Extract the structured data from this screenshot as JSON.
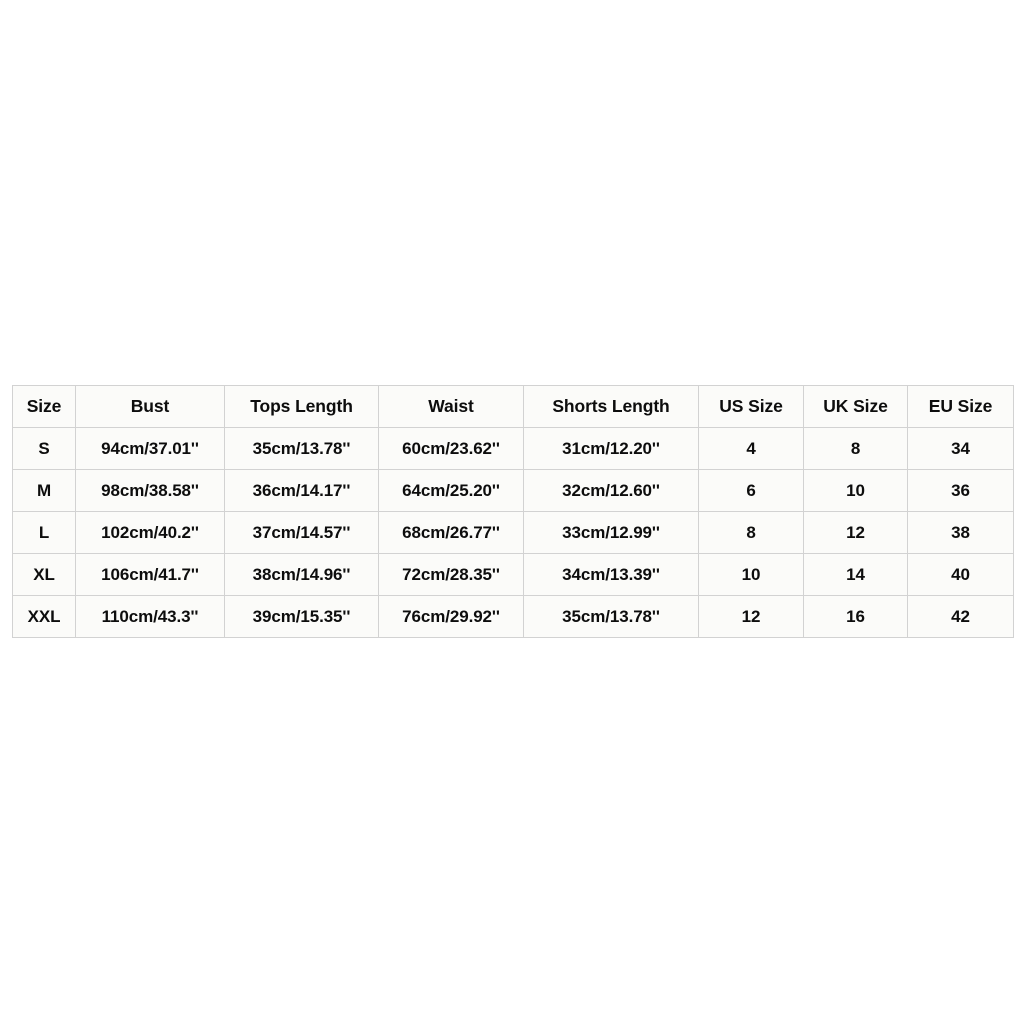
{
  "page": {
    "background_color": "#ffffff",
    "table_background_color": "#fbfbf9",
    "border_color": "#d2d2d2",
    "text_color": "#0d0d0d"
  },
  "chart_data": {
    "type": "table",
    "title": "",
    "columns": [
      "Size",
      "Bust",
      "Tops Length",
      "Waist",
      "Shorts Length",
      "US Size",
      "UK Size",
      "EU Size"
    ],
    "rows": [
      {
        "size": "S",
        "bust": "94cm/37.01''",
        "tops_length": "35cm/13.78''",
        "waist": "60cm/23.62''",
        "shorts_length": "31cm/12.20''",
        "us_size": "4",
        "uk_size": "8",
        "eu_size": "34"
      },
      {
        "size": "M",
        "bust": "98cm/38.58''",
        "tops_length": "36cm/14.17''",
        "waist": "64cm/25.20''",
        "shorts_length": "32cm/12.60''",
        "us_size": "6",
        "uk_size": "10",
        "eu_size": "36"
      },
      {
        "size": "L",
        "bust": "102cm/40.2''",
        "tops_length": "37cm/14.57''",
        "waist": "68cm/26.77''",
        "shorts_length": "33cm/12.99''",
        "us_size": "8",
        "uk_size": "12",
        "eu_size": "38"
      },
      {
        "size": "XL",
        "bust": "106cm/41.7''",
        "tops_length": "38cm/14.96''",
        "waist": "72cm/28.35''",
        "shorts_length": "34cm/13.39''",
        "us_size": "10",
        "uk_size": "14",
        "eu_size": "40"
      },
      {
        "size": "XXL",
        "bust": "110cm/43.3''",
        "tops_length": "39cm/15.35''",
        "waist": "76cm/29.92''",
        "shorts_length": "35cm/13.78''",
        "us_size": "12",
        "uk_size": "16",
        "eu_size": "42"
      }
    ]
  }
}
